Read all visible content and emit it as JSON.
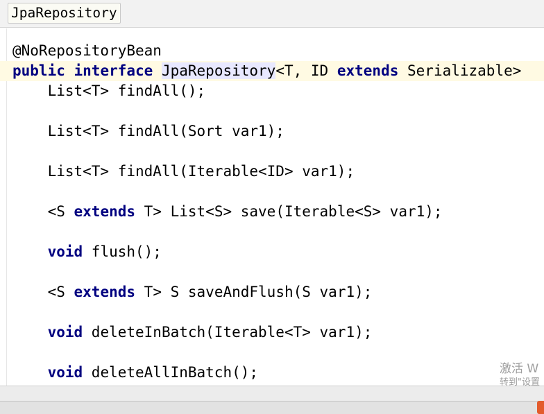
{
  "breadcrumb": {
    "label": "JpaRepository"
  },
  "code": {
    "annotation": "@NoRepositoryBean",
    "declaration": {
      "kw_public": "public",
      "kw_interface": "interface",
      "name": "JpaRepository",
      "generic_start": "<T, ID ",
      "kw_extends": "extends",
      "generic_end": " Serializable>"
    },
    "l1": {
      "indent": "    ",
      "text": "List<T> findAll();"
    },
    "l2": {
      "indent": "    ",
      "text": "List<T> findAll(Sort var1);"
    },
    "l3": {
      "indent": "    ",
      "text": "List<T> findAll(Iterable<ID> var1);"
    },
    "l4": {
      "indent": "    ",
      "pre": "<S ",
      "kw": "extends",
      "post": " T> List<S> save(Iterable<S> var1);"
    },
    "l5": {
      "indent": "    ",
      "kw": "void",
      "post": " flush();"
    },
    "l6": {
      "indent": "    ",
      "pre": "<S ",
      "kw": "extends",
      "post": " T> S saveAndFlush(S var1);"
    },
    "l7": {
      "indent": "    ",
      "kw": "void",
      "post": " deleteInBatch(Iterable<T> var1);"
    },
    "l8": {
      "indent": "    ",
      "kw": "void",
      "post": " deleteAllInBatch();"
    }
  },
  "watermark": {
    "line1": "激活 W",
    "line2": "转到\"设置"
  },
  "colors": {
    "keyword": "#000080",
    "current_line": "#fffae3",
    "name_highlight": "#e8e8ff"
  }
}
